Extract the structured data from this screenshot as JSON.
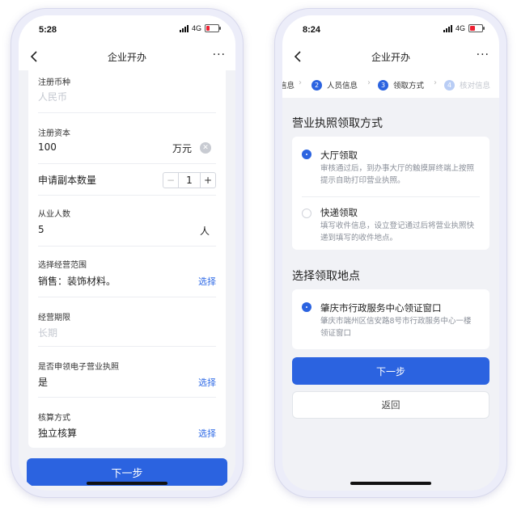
{
  "left_phone": {
    "status": {
      "time": "5:28",
      "network": "4G"
    },
    "nav": {
      "title": "企业开办",
      "more": "···"
    },
    "form": {
      "currency_label": "注册币种",
      "currency_placeholder": "人民币",
      "capital_label": "注册资本",
      "capital_value": "100",
      "capital_unit": "万元",
      "copies_label": "申请副本数量",
      "copies_value": "1",
      "copies_minus": "−",
      "copies_plus": "+",
      "employees_label": "从业人数",
      "employees_value": "5",
      "employees_unit": "人",
      "scope_label": "选择经营范围",
      "scope_value": "销售：装饰材料。",
      "scope_action": "选择",
      "term_label": "经营期限",
      "term_placeholder": "长期",
      "elicense_label": "是否申领电子营业执照",
      "elicense_value": "是",
      "elicense_action": "选择",
      "accounting_label": "核算方式",
      "accounting_value": "独立核算",
      "accounting_action": "选择"
    },
    "next_button": "下一步"
  },
  "right_phone": {
    "status": {
      "time": "8:24",
      "network": "4G"
    },
    "nav": {
      "title": "企业开办",
      "more": "···"
    },
    "steps": [
      {
        "num": "",
        "label": "信息"
      },
      {
        "num": "2",
        "label": "人员信息"
      },
      {
        "num": "3",
        "label": "领取方式"
      },
      {
        "num": "4",
        "label": "核对信息"
      }
    ],
    "pickup_title": "营业执照领取方式",
    "options": [
      {
        "title": "大厅领取",
        "desc": "审核通过后，到办事大厅的触摸屏终端上按照提示自助打印营业执照。",
        "selected": true
      },
      {
        "title": "快递领取",
        "desc": "填写收件信息，设立登记通过后将营业执照快递到填写的收件地点。",
        "selected": false
      }
    ],
    "location_title": "选择领取地点",
    "location": {
      "title": "肇庆市行政服务中心领证窗口",
      "desc": "肇庆市端州区信安路8号市行政服务中心一楼领证窗口",
      "selected": true
    },
    "next_button": "下一步",
    "back_button": "返回"
  },
  "colors": {
    "primary": "#2b63e0",
    "link": "#2f6ae6",
    "battery_low": "#ee2233"
  }
}
